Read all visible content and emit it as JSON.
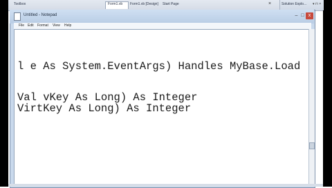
{
  "ide": {
    "left_pane_title": "Toolbox",
    "tab_form_vb": "Form1.vb",
    "tab_form_design": "Form1.vb [Design]",
    "tab_start_page": "Start Page",
    "close_glyph": "×",
    "solution_pane_title": "Solution Explo...",
    "pane_buttons": "▾ ⊓ ×"
  },
  "notepad": {
    "title": "Untitled - Notepad",
    "min_glyph": "–",
    "max_glyph": "□",
    "close_glyph": "x",
    "menu": [
      "File",
      "Edit",
      "Format",
      "View",
      "Help"
    ],
    "lines": [
      "l e As System.EventArgs) Handles MyBase.Load",
      "Val vKey As Long) As Integer",
      "VirtKey As Long) As Integer"
    ]
  }
}
